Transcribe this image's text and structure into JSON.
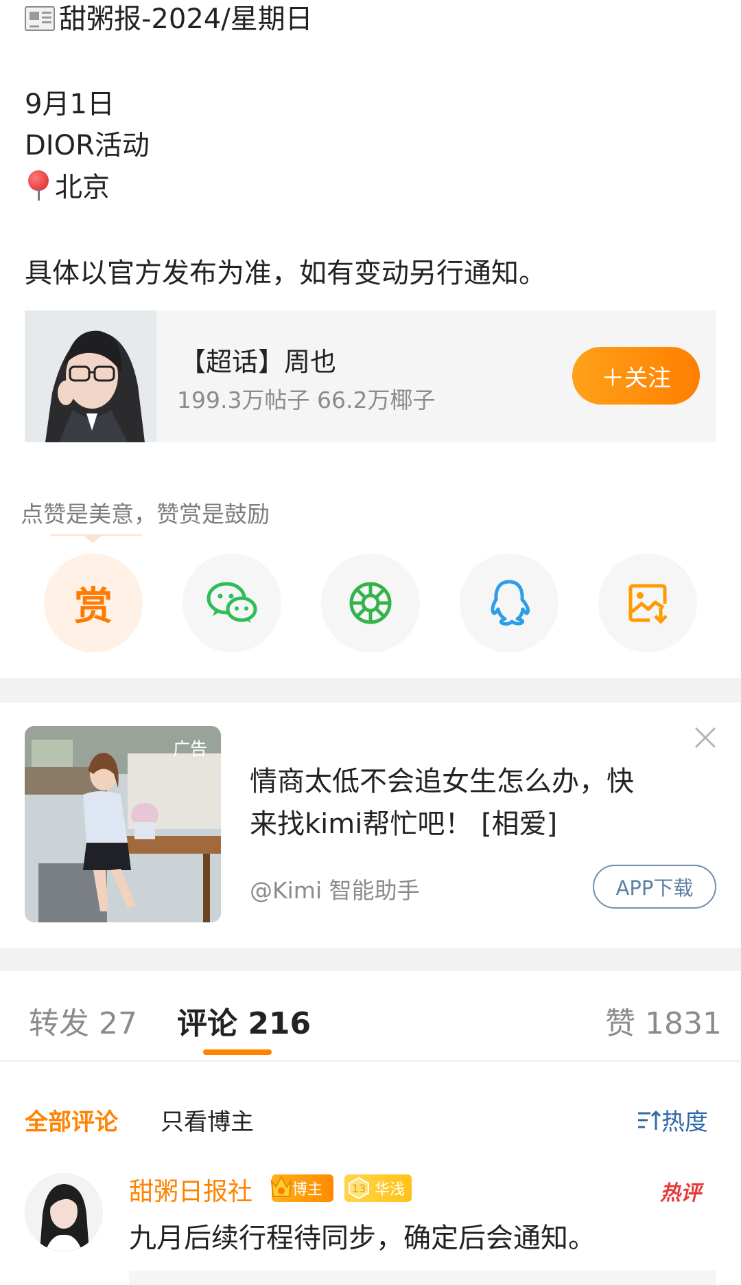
{
  "post": {
    "header_icon": "newspaper-emoji",
    "title": "甜粥报-2024/星期日",
    "date": "9月1日",
    "event": "DIOR活动",
    "location_icon": "pushpin-emoji",
    "location": "北京",
    "note": "具体以官方发布为准，如有变动另行通知。"
  },
  "topic_card": {
    "title": "【超话】周也",
    "stats": "199.3万帖子 66.2万椰子",
    "follow_label": "＋关注",
    "accent": "#ff8200"
  },
  "reward": {
    "hint": "点赞是美意，赞赏是鼓励",
    "reward_char": "赏"
  },
  "share": {
    "icons": [
      "reward-icon",
      "wechat-icon",
      "moments-icon",
      "qq-icon",
      "save-image-icon"
    ]
  },
  "ad": {
    "label": "广告",
    "text_line1": "情商太低不会追女生怎么办，快",
    "text_line2": "来找kimi帮忙吧！ [相爱]",
    "author": "@Kimi 智能助手",
    "download_label": "APP下载"
  },
  "tabs": {
    "repost": "转发 27",
    "comment": "评论 216",
    "like": "赞 1831"
  },
  "filters": {
    "all": "全部评论",
    "blogger_only": "只看博主",
    "sort": "热度"
  },
  "comment": {
    "name": "甜粥日报社",
    "badge_blogger": "博主",
    "badge_level_num": "13",
    "badge_level": "华浅",
    "hot_tag": "热评",
    "text": "九月后续行程待同步，确定后会通知。"
  }
}
